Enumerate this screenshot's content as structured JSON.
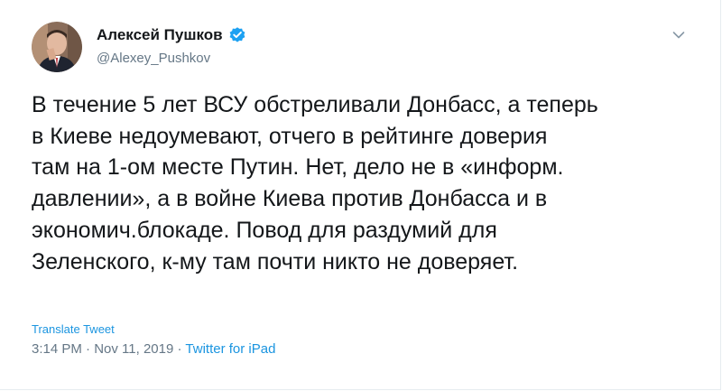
{
  "author": {
    "name": "Алексей Пушков",
    "handle": "@Alexey_Pushkov",
    "verified": true
  },
  "tweet": {
    "text": "В течение 5 лет ВСУ обстреливали Донбасс, а теперь\nв Киеве недоумевают, отчего в рейтинге доверия\nтам на 1-ом месте Путин. Нет, дело не в «информ.\nдавлении», а в войне Киева против Донбасса и в\nэкономич.блокаде. Повод для раздумий для\nЗеленского, к-му там почти никто не доверяет.",
    "translate_label": "Translate Tweet",
    "time": "3:14 PM",
    "separator": "·",
    "date": "Nov 11, 2019",
    "source": "Twitter for iPad"
  },
  "colors": {
    "accent": "#1b95e0",
    "verified_badge": "#1da1f2",
    "muted_text": "#657786",
    "body_text": "#14171a"
  },
  "icons": {
    "verified": "verified-badge-icon",
    "menu": "chevron-down-icon"
  }
}
